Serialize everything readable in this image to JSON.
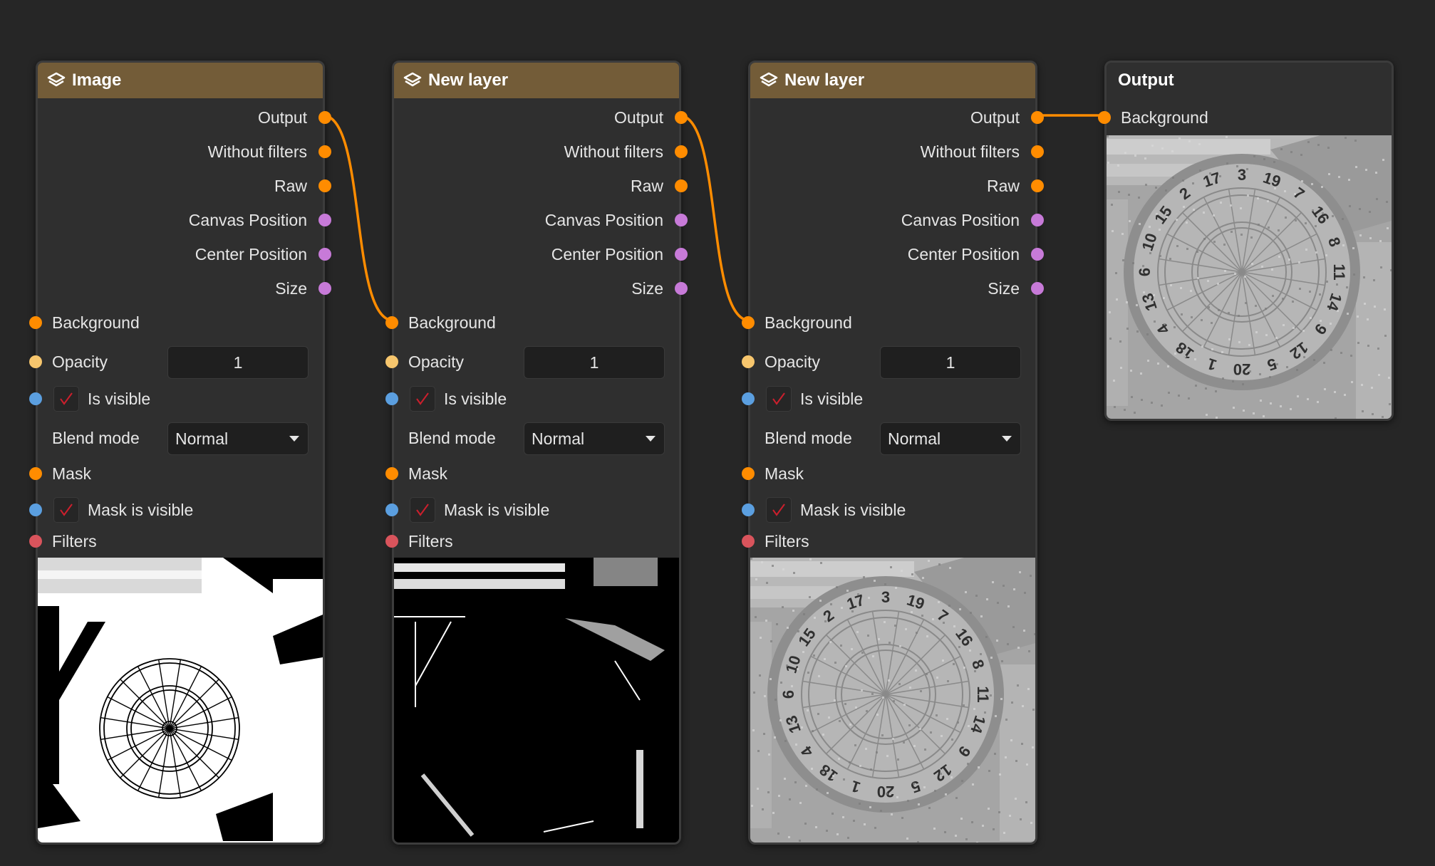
{
  "nodes": [
    {
      "title": "Image",
      "outputs": [
        "Output",
        "Without filters",
        "Raw",
        "Canvas Position",
        "Center Position",
        "Size"
      ],
      "background_label": "Background",
      "opacity_label": "Opacity",
      "opacity_value": "1",
      "is_visible_label": "Is visible",
      "blend_mode_label": "Blend mode",
      "blend_mode_value": "Normal",
      "mask_label": "Mask",
      "mask_visible_label": "Mask is visible",
      "filters_label": "Filters"
    },
    {
      "title": "New layer",
      "outputs": [
        "Output",
        "Without filters",
        "Raw",
        "Canvas Position",
        "Center Position",
        "Size"
      ],
      "background_label": "Background",
      "opacity_label": "Opacity",
      "opacity_value": "1",
      "is_visible_label": "Is visible",
      "blend_mode_label": "Blend mode",
      "blend_mode_value": "Normal",
      "mask_label": "Mask",
      "mask_visible_label": "Mask is visible",
      "filters_label": "Filters"
    },
    {
      "title": "New layer",
      "outputs": [
        "Output",
        "Without filters",
        "Raw",
        "Canvas Position",
        "Center Position",
        "Size"
      ],
      "background_label": "Background",
      "opacity_label": "Opacity",
      "opacity_value": "1",
      "is_visible_label": "Is visible",
      "blend_mode_label": "Blend mode",
      "blend_mode_value": "Normal",
      "mask_label": "Mask",
      "mask_visible_label": "Mask is visible",
      "filters_label": "Filters"
    }
  ],
  "output_node": {
    "title": "Output",
    "input_label": "Background"
  },
  "dart_numbers": [
    "20",
    "1",
    "18",
    "4",
    "13",
    "6",
    "10",
    "15",
    "2",
    "17",
    "3",
    "19",
    "7",
    "16",
    "8",
    "11",
    "14",
    "9",
    "12",
    "5"
  ],
  "colors": {
    "background": "#262626",
    "node_body": "#2f2f2f",
    "layer_header": "#735c38",
    "wire": "#ff8c00",
    "socket_image": "#ff8c00",
    "socket_vector": "#c77ad8",
    "socket_float": "#f7c66d",
    "socket_bool": "#5b9fe0",
    "socket_filter": "#d9545c",
    "check": "#cc1f2d"
  },
  "icons": {
    "layer_header": "layers-icon",
    "dropdown": "chevron-down-icon",
    "checkbox": "checkmark-icon"
  }
}
